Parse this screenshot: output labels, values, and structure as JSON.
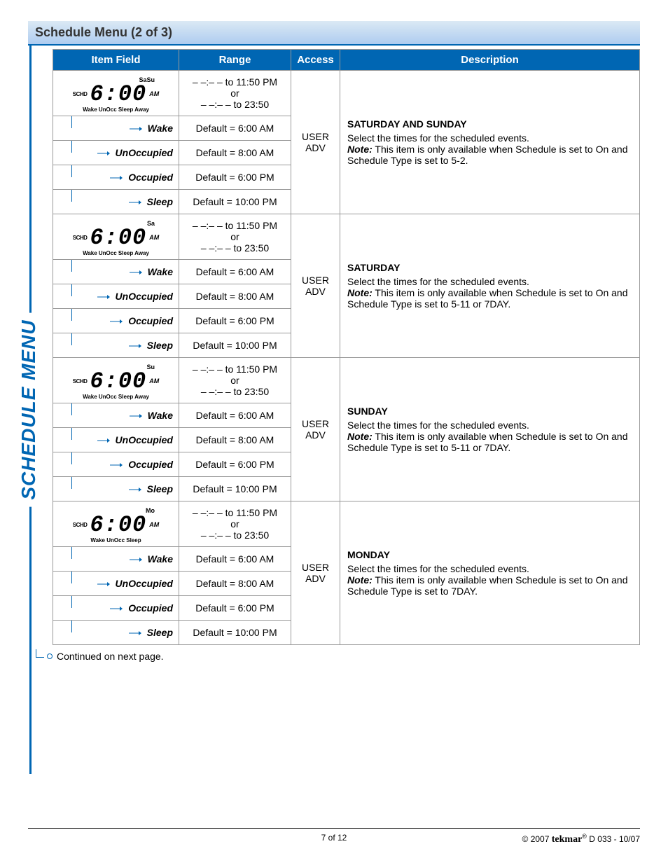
{
  "title": "Schedule Menu (2 of 3)",
  "side_label": "SCHEDULE MENU",
  "headers": {
    "item": "Item Field",
    "range": "Range",
    "access": "Access",
    "desc": "Description"
  },
  "range_main_1": "– –:– – to 11:50 PM",
  "range_main_or": "or",
  "range_main_2": "– –:– – to 23:50",
  "defaults": {
    "wake": "Default = 6:00 AM",
    "unocc": "Default = 8:00 AM",
    "occ": "Default = 6:00 PM",
    "sleep": "Default = 10:00 PM"
  },
  "access_user": "USER",
  "access_adv": "ADV",
  "sub_labels": {
    "wake": "Wake",
    "unocc": "UnOccupied",
    "occ": "Occupied",
    "sleep": "Sleep"
  },
  "lcd": {
    "schd": "SCHD",
    "time": "6:00",
    "ampm": "AM",
    "bottom_full": "Wake UnOcc Sleep Away",
    "bottom_short": "Wake UnOcc Sleep"
  },
  "groups": [
    {
      "day_code": "SaSu",
      "title": "SATURDAY AND SUNDAY",
      "select": "Select the times for the scheduled events.",
      "note_label": "Note:",
      "note_text": " This item is only available when Schedule is set to On and Schedule Type is set to 5-2.",
      "bottom": "full"
    },
    {
      "day_code": "Sa",
      "title": "SATURDAY",
      "select": "Select the times for the scheduled events.",
      "note_label": "Note:",
      "note_text": " This item is only available when Schedule is set to On and Schedule Type is set to 5-11 or 7DAY.",
      "bottom": "full"
    },
    {
      "day_code": "Su",
      "title": "SUNDAY",
      "select": "Select the times for the scheduled events.",
      "note_label": "Note:",
      "note_text": " This item is only available when Schedule is set to On and Schedule Type is set to 5-11 or 7DAY.",
      "bottom": "full"
    },
    {
      "day_code": "Mo",
      "title": "MONDAY",
      "select": "Select the times for the scheduled events.",
      "note_label": "Note:",
      "note_text": " This item is only available when Schedule is set to On and Schedule Type is set to 7DAY.",
      "bottom": "short"
    }
  ],
  "continued": "Continued on next page.",
  "footer": {
    "page": "7 of 12",
    "copyright": "© 2007 ",
    "brand": "tekmar",
    "doc": " D 033 - 10/07"
  }
}
